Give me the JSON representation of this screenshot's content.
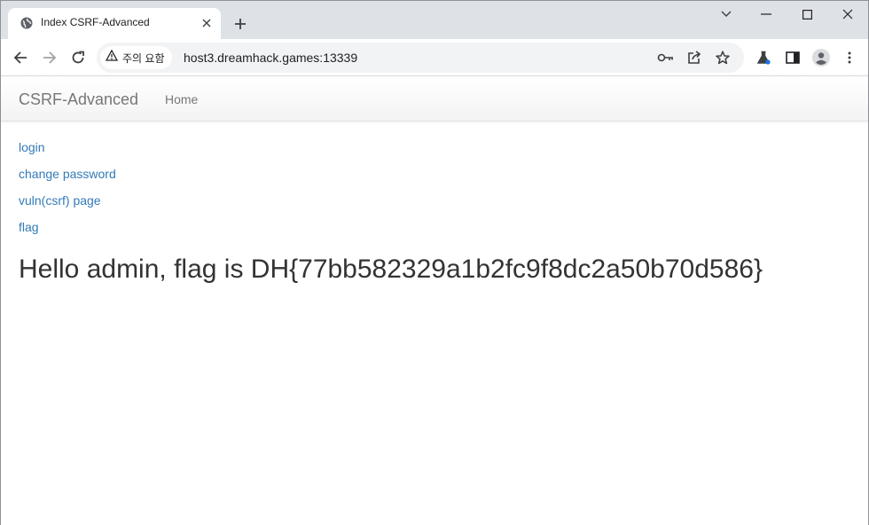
{
  "browser": {
    "tab": {
      "title": "Index CSRF-Advanced"
    },
    "security_chip": {
      "label": "주의 요함"
    },
    "address_bar": {
      "url": "host3.dreamhack.games:13339"
    }
  },
  "page": {
    "navbar": {
      "brand": "CSRF-Advanced",
      "home_label": "Home"
    },
    "links": [
      {
        "label": "login"
      },
      {
        "label": "change password"
      },
      {
        "label": "vuln(csrf) page"
      },
      {
        "label": "flag"
      }
    ],
    "message": "Hello admin, flag is DH{77bb582329a1b2fc9f8dc2a50b70d586}"
  },
  "colors": {
    "link": "#337ab7",
    "navbar_text": "#777777",
    "tabstrip_bg": "#dee1e6",
    "omnibox_bg": "#f1f3f4"
  }
}
